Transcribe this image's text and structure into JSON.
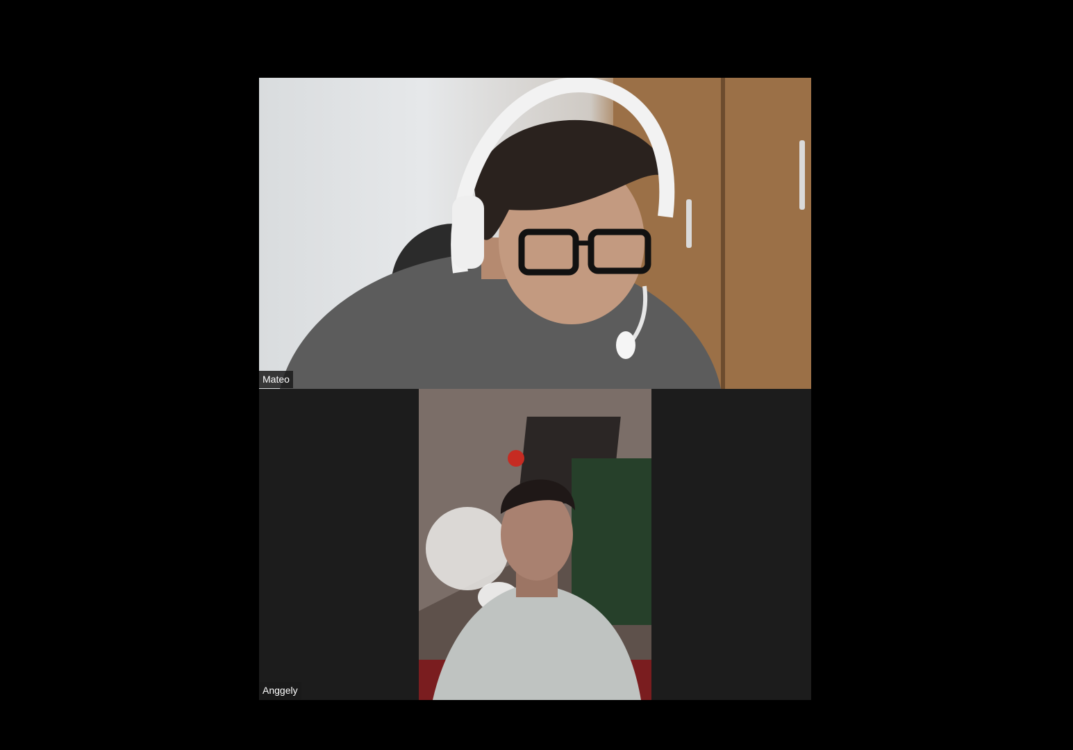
{
  "participants": [
    {
      "name": "Mateo"
    },
    {
      "name": "Anggely"
    }
  ],
  "colors": {
    "background": "#000000",
    "tile_background": "#1c1c1c",
    "label_text": "#ffffff"
  }
}
